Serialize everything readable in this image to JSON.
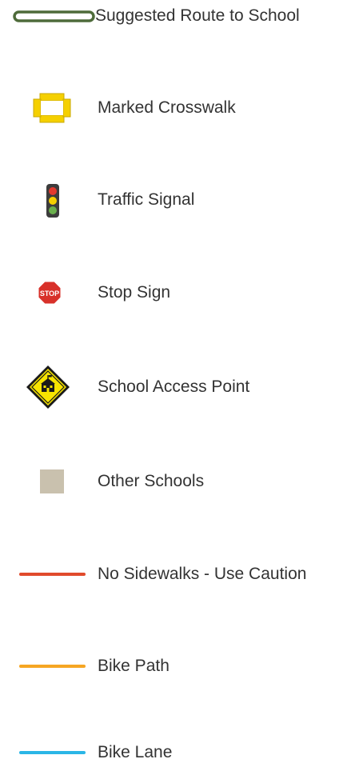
{
  "legend": {
    "items": [
      {
        "id": "route",
        "label": "Suggested Route to School",
        "icon": "route-line-icon",
        "color": "#4e6b3a"
      },
      {
        "id": "crosswalk",
        "label": "Marked Crosswalk",
        "icon": "crosswalk-icon",
        "color": "#f5d000"
      },
      {
        "id": "signal",
        "label": "Traffic Signal",
        "icon": "traffic-signal-icon",
        "color": "#3c3c3c"
      },
      {
        "id": "stop",
        "label": "Stop Sign",
        "icon": "stop-sign-icon",
        "color": "#d8312a",
        "icon_text": "STOP"
      },
      {
        "id": "access",
        "label": "School Access Point",
        "icon": "school-access-icon",
        "color": "#f7e400"
      },
      {
        "id": "other_schools",
        "label": "Other Schools",
        "icon": "other-schools-swatch",
        "color": "#c9c1ae"
      },
      {
        "id": "no_sidewalks",
        "label": "No Sidewalks - Use Caution",
        "icon": "red-line-icon",
        "color": "#e14a2c"
      },
      {
        "id": "bike_path",
        "label": "Bike Path",
        "icon": "orange-line-icon",
        "color": "#f6a623"
      },
      {
        "id": "bike_lane",
        "label": "Bike Lane",
        "icon": "blue-line-icon",
        "color": "#2bb6e6"
      }
    ]
  }
}
